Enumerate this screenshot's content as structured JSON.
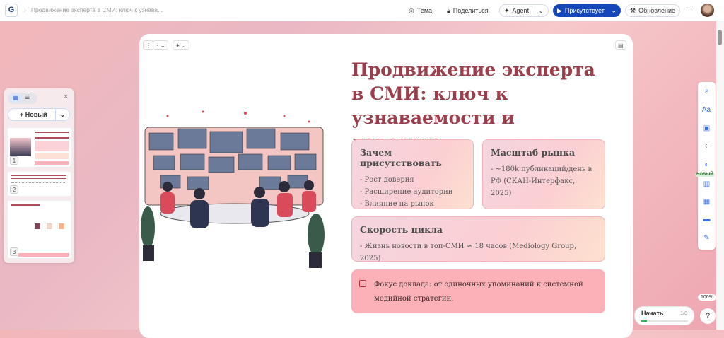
{
  "topbar": {
    "logo": "G",
    "breadcrumb": "Продвижение эксперта в СМИ: ключ к узнава...",
    "theme": "Тема",
    "share": "Поделиться",
    "agent": "Agent",
    "present": "Присутствует",
    "update": "Обновление",
    "more": "···"
  },
  "panel": {
    "new_label": "Новый",
    "close": "×",
    "thumbs": [
      "1",
      "2",
      "3"
    ]
  },
  "slide": {
    "title": "Продвижение эксперта в СМИ: ключ к узнаваемости и доверию",
    "cards": [
      {
        "title": "Зачем присутствовать",
        "items": [
          "- Рост доверия",
          "- Расширение аудитории",
          "- Влияние на рынок"
        ]
      },
      {
        "title": "Масштаб рынка",
        "items": [
          "- ~180k публикаций/день в РФ (СКАН-Интерфакс, 2025)"
        ]
      },
      {
        "title": "Скорость цикла",
        "items": [
          "- Жизнь новости в топ-СМИ ≈ 18 часов (Mediology Group, 2025)"
        ]
      }
    ],
    "callout": "Фокус доклада: от одиночных упоминаний к системной медийной стратегии."
  },
  "right_toolbar": {
    "new_badge": "НОВЫЙ"
  },
  "zoom": "100%",
  "start": {
    "label": "Начать",
    "progress_text": "1/8",
    "progress": 0.125
  },
  "help": "?"
}
